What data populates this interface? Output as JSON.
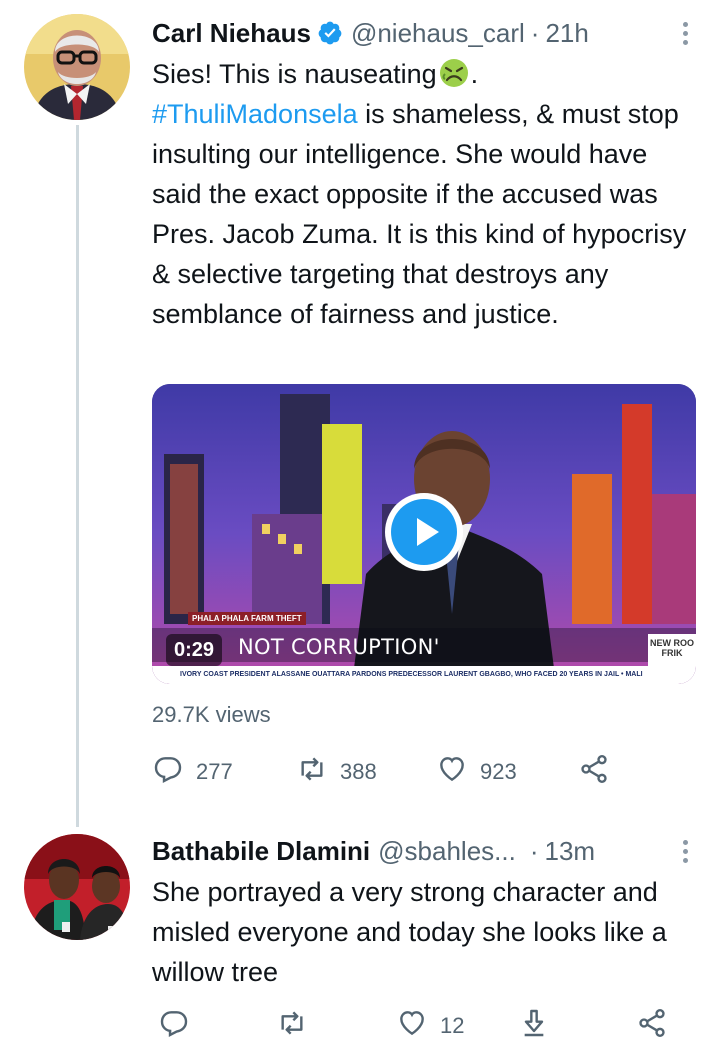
{
  "tweets": [
    {
      "display_name": "Carl Niehaus",
      "verified": true,
      "handle": "@niehaus_carl",
      "time": "21h",
      "text_intro": "Sies! This is nauseating",
      "text_after_emoji": ".",
      "hashtag": "#ThuliMadonsela",
      "text_body": " is shameless, & must stop insulting our intelligence. She would have said the exact opposite if the accused was Pres. Jacob Zuma. It is this kind of hypocrisy & selective targeting that destroys any semblance of fairness and justice.",
      "media": {
        "duration": "0:29",
        "headline": "NOT CORRUPTION'",
        "label": "PHALA PHALA FARM THEFT",
        "ticker": "IVORY COAST PRESIDENT ALASSANE OUATTARA PARDONS PREDECESSOR LAURENT GBAGBO, WHO FACED 20 YEARS IN JAIL  •  MALI",
        "brand": "NEW ROO FRIK"
      },
      "views": "29.7K views",
      "actions": {
        "replies": "277",
        "retweets": "388",
        "likes": "923"
      }
    },
    {
      "display_name": "Bathabile Dlamini",
      "handle": "@sbahles...",
      "time": "13m",
      "text": "She portrayed a very strong character and misled everyone and today she looks like a willow tree",
      "actions": {
        "replies": "",
        "retweets": "",
        "likes": "12"
      }
    }
  ],
  "colors": {
    "accent": "#1d9bf0",
    "muted": "#536471",
    "thread_line": "#cfd9de"
  },
  "icons": [
    "verified-badge-icon",
    "more-icon",
    "reply-icon",
    "retweet-icon",
    "like-icon",
    "share-icon",
    "download-icon",
    "play-icon",
    "nauseated-face-emoji"
  ]
}
